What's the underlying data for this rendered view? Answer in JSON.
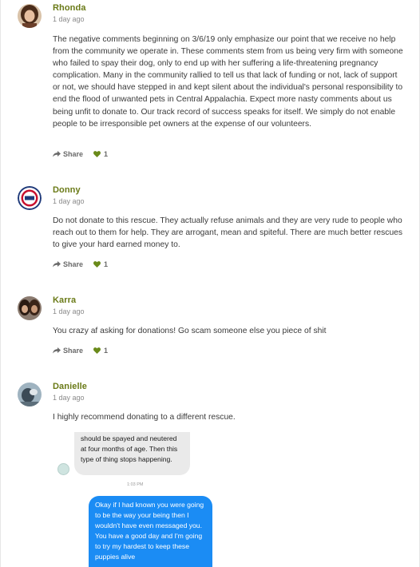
{
  "comments": [
    {
      "name": "Rhonda",
      "time": "1 day ago",
      "body": "The negative comments beginning on 3/6/19 only emphasize our point that we receive no help from the community we operate in. These comments stem from us being very firm with someone who failed to spay their dog, only to end up with her suffering a life-threatening pregnancy complication. Many in the community rallied to tell us that lack of funding or not, lack of support or not, we should have stepped in and kept silent about the individual's personal responsibility to end the flood of unwanted pets in Central Appalachia. Expect more nasty comments about us being unfit to donate to. Our track record of success speaks for itself. We simply do not enable people to be irresponsible pet owners at the expense of our volunteers.",
      "share_label": "Share",
      "likes": "1"
    },
    {
      "name": "Donny",
      "time": "1 day ago",
      "body": "Do not donate to this rescue. They actually refuse animals and they are very rude to people who reach out to them for help. They are arrogant, mean and spiteful. There are much better rescues to give your hard earned money to.",
      "share_label": "Share",
      "likes": "1"
    },
    {
      "name": "Karra",
      "time": "1 day ago",
      "body": "You crazy af asking for donations! Go scam someone else you piece of shit",
      "share_label": "Share",
      "likes": "1"
    },
    {
      "name": "Danielle",
      "time": "1 day ago",
      "body": "I highly recommend donating to a different rescue."
    }
  ],
  "screenshot": {
    "grey_message": "should be spayed and neutered at four months of age. Then this type of thing stops happening.",
    "timestamp": "1:03 PM",
    "blue_message": "Okay if I had known you were going to be the way your being then I wouldn't have even messaged you. You have a good day and I'm going to try my hardest to keep these puppies alive"
  },
  "colors": {
    "name": "#6a7a17",
    "like_heart": "#6a8a1a",
    "bubble_blue": "#1b8cf4",
    "bubble_grey": "#eaeaea"
  },
  "icons": {
    "share": "share-arrow-icon",
    "like": "heart-icon"
  }
}
